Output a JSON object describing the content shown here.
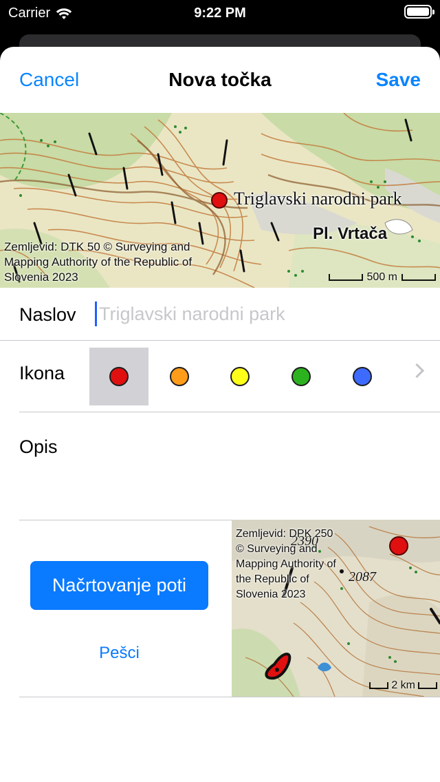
{
  "status_bar": {
    "carrier": "Carrier",
    "time": "9:22 PM",
    "icons": [
      "wifi-icon",
      "battery-icon"
    ]
  },
  "nav": {
    "cancel_label": "Cancel",
    "title": "Nova točka",
    "save_label": "Save"
  },
  "map_preview": {
    "point_label": "Triglavski narodni park",
    "place_label": "Pl. Vrtača",
    "attribution": "Zemljevid: DTK 50 © Surveying and Mapping Authority of the Republic of Slovenia 2023",
    "scale": "500 m",
    "pin_color": "#e01010"
  },
  "form": {
    "title_label": "Naslov",
    "title_value": "",
    "title_placeholder": "Triglavski narodni park",
    "icon_label": "Ikona",
    "icons": [
      {
        "name": "red-dot-icon",
        "color": "#e01010",
        "selected": true
      },
      {
        "name": "orange-dot-icon",
        "color": "#ff9c1a",
        "selected": false
      },
      {
        "name": "yellow-dot-icon",
        "color": "#ffff1a",
        "selected": false
      },
      {
        "name": "green-dot-icon",
        "color": "#2cb21f",
        "selected": false
      },
      {
        "name": "blue-dot-icon",
        "color": "#3e6bff",
        "selected": false
      }
    ],
    "more_icon": "chevron-right-icon",
    "description_label": "Opis",
    "description_value": ""
  },
  "route": {
    "button_label": "Načrtovanje poti",
    "mode_label": "Pešci",
    "map": {
      "attribution": "Zemljevid: DPK 250 © Surveying and Mapping Authority of the Republic of Slovenia 2023",
      "scale": "2 km",
      "elevations": [
        "2390",
        "2087"
      ]
    }
  },
  "colors": {
    "accent": "#0a84ff",
    "button": "#0a7aff",
    "separator": "#c8c7cc"
  }
}
